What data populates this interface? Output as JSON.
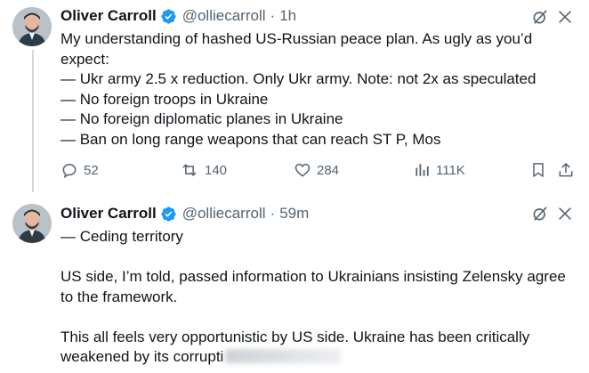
{
  "tweets": [
    {
      "author": {
        "name": "Oliver Carroll",
        "handle": "@olliecarroll",
        "verified": true
      },
      "time": "1h",
      "lines": [
        "My understanding of hashed US-Russian peace plan. As ugly as you’d",
        "expect:",
        "— Ukr army 2.5 x reduction. Only Ukr army. Note: not 2x as speculated",
        "— No foreign troops in Ukraine",
        "— No foreign diplomatic planes in Ukraine",
        "— Ban on long range weapons that can reach ST P, Mos"
      ],
      "stats": {
        "replies": "52",
        "reposts": "140",
        "likes": "284",
        "views": "111K"
      }
    },
    {
      "author": {
        "name": "Oliver Carroll",
        "handle": "@olliecarroll",
        "verified": true
      },
      "time": "59m",
      "lines": [
        "— Ceding territory",
        "",
        "US side, I’m told, passed information to Ukrainians insisting Zelensky agree",
        "to the framework.",
        "",
        "This all feels very opportunistic by US side. Ukraine has been critically",
        "weakened by its corrupti"
      ]
    }
  ],
  "colors": {
    "verified": "#1d9bf0",
    "secondary": "#536471",
    "thread_line": "#cfd9de"
  },
  "icons": [
    "grok-icon",
    "more-icon",
    "reply-icon",
    "repost-icon",
    "like-icon",
    "views-icon",
    "bookmark-icon",
    "share-icon",
    "verified-icon"
  ]
}
